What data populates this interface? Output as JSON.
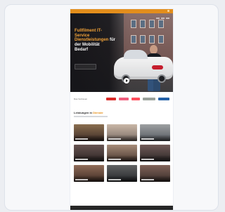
{
  "hero": {
    "title_orange": "Fullfilment IT-",
    "title_orange_2": "Service",
    "title_orange_3": "Dienstleistungen",
    "title_white": "für",
    "title_white_2": "der Mobilität",
    "title_white_3": "Bedarf"
  },
  "partners": {
    "label": "Das Vertrauen"
  },
  "section": {
    "title_dark": "Leistungen in",
    "title_accent": "Dienste"
  },
  "colors": {
    "accent": "#e38e1c",
    "accent_text": "#f1a238",
    "dark": "#171a20"
  }
}
